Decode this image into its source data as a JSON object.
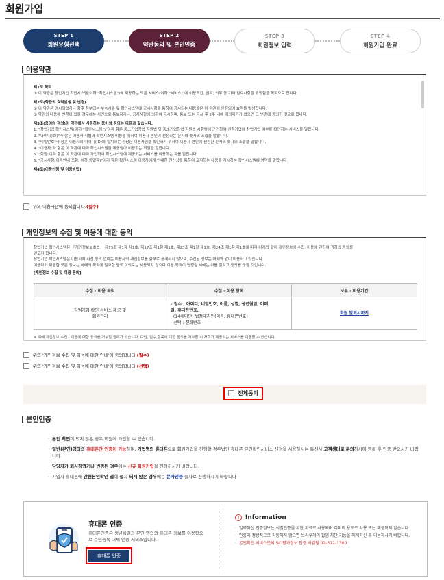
{
  "page": {
    "title": "회원가입"
  },
  "steps": [
    {
      "num": "STEP 1",
      "label": "회원유형선택"
    },
    {
      "num": "STEP 2",
      "label": "약관동의 및 본인인증"
    },
    {
      "num": "STEP 3",
      "label": "회원정보 입력"
    },
    {
      "num": "STEP 4",
      "label": "회원가입 완료"
    }
  ],
  "terms": {
    "section_title": "이용약관",
    "lines": [
      {
        "text": "제1조 목적",
        "bold": true
      },
      {
        "text": "① 이 약관은 창업기업 확인시스템(이하 \"확인시스템\")에 제공하는 모든 서비스(이하 \"서비스\")에 이용조건, 권리, 의무 등 기타 필요사항을 규정함을 목적으로 합니다.",
        "bold": false
      },
      {
        "text": "제2조(약관의 효력발생 및 변경)",
        "bold": true
      },
      {
        "text": "① 이 약관은 명시되었거나 향후 첨부되는 부속서류 및 확인시스템에 공시사항을 통하여 공시되는 내용들은 이 약관에 인정되어 효력을 발생합니다.",
        "bold": false
      },
      {
        "text": "② 약관의 내용에 변경이 있을 경우에는 서면으로 통보하거나, 공지사항에 의하여 공시하며, 통보 또는 공시 후 2주 내에 이의제기가 없으면 그 변경에 동의한 것으로 봅니다.",
        "bold": false
      },
      {
        "text": "제3조(용어의 정의)이 약관에서 사용하는 용어의 정의는 다음과 같습니다.",
        "bold": true
      },
      {
        "text": "1. \"창업기업 확인시스템(이하 \"확인시스템\")\"이라 함은 중소기업창업 지원법 및 중소기업창업 지원법 시행령에 근거하여 신청기업에 창업기업 여부를 확인하는 서비스를 말합니다.",
        "bold": false
      },
      {
        "text": "2. \"아이디(ID)\"라 함은 이용자 식별과 확인시스템 이용을 위하여 이용자 본인이 선정하는 문자와 숫자의 조합을 말합니다.",
        "bold": false
      },
      {
        "text": "3. \"비밀번호\"라 함은 이용자의 아이디(ID)와 일치하는 정당한 이용자임을 확인하기 위하여 이용자 본인이 선정한 문자와 숫자의 조합을 말합니다.",
        "bold": false
      },
      {
        "text": "4. \"이용자\"라 함은 이 약관에 따라 확인시스템을 제공받아 이용하는 회원을 말합니다.",
        "bold": false
      },
      {
        "text": "5. \"회원\"이라 함은 이 약관에 따라 가입하여 확인시스템에 제공되는 서비스를 이용하는 자를 말합니다.",
        "bold": false
      },
      {
        "text": "6. \"공시사항(이용안내 포함, 이하 동일함)\"이라 함은 확인시스템 이용자에게 안내한 전산상을 통하여 고지하는 내용을 게시하는 확인시스템에 영역을 말합니다.",
        "bold": false
      },
      {
        "text": "제4조(이용신청 및 이용방법)",
        "bold": true
      }
    ],
    "agree_label": "위의 이용약관에 동의합니다.",
    "agree_required": "(필수)"
  },
  "privacy": {
    "section_title": "개인정보의 수집 및 이용에 대한 동의",
    "intro_lines": [
      "창업기업 확인시스템은 「개인정보보호법」 제15조 제1항 제1호, 제17조 제1항 제1호, 제23조 제1항 제1호, 제24조 제1항 제1호에 따라 아래와 같이 개인정보에 수집. 이용에 관하여 귀하의 동의를",
      "얻고자 합니다.",
      "창업기업 확인시스템은 이용자에 사전 동의 없이는 이용자의 개인정보를 함부로 공개하지 않으며, 수집된 정보는 아래와 같이 이용하고 있습니다.",
      "이용자가 제공한 모든 정보는 아래의 목적에 필요한 용도 이외로는 사용되지 않으며 이용 목적이 변경될 시에는 이를 알리고 동의를 구할 것입니다."
    ],
    "table_caption": "[개인정보 수집 및 이용 동의]",
    "table_headers": [
      "수집 · 이용 목적",
      "수집 · 이용 항목",
      "보유 · 이용기간"
    ],
    "table_purpose": "창업기업 확인 서비스 제공 및\n회원관리",
    "table_items": [
      "- 필수 : 아이디, 비밀번호, 이름, 성별, 생년월일, 이메",
      "일, 휴대폰번호,",
      "  (14세미만) 법정대리인(이름, 휴대폰번호)",
      "- 선택 : 전화번호"
    ],
    "table_period": "회원 탈퇴시까지",
    "note": "※ 위에 개인정보 수집 · 이용에 대한 동의를 거부할 권리가 있습니다. 다만, 필수 항목에 대한 동의를 거부할 시 저희가 제공하는 서비스를 이용할 수 없습니다.",
    "agree_required_label": "위의 '개인정보 수집 및 이용에 대한 안내'에 동의합니다.",
    "agree_required_tag": "(필수)",
    "agree_optional_label": "위의 '개인정보 수집 및 이용에 대한 안내'에 동의합니다.",
    "agree_optional_tag": "(선택)"
  },
  "agree_all": {
    "label": "전체동의"
  },
  "identity": {
    "section_title": "본인인증",
    "notes": [
      {
        "a": "본인 확인",
        "b": "이 되지 않은 경우 회원에 가입할 수 없습니다."
      },
      {
        "a": "일반(본인)명의의",
        "b": " 휴대폰만 인증이 가능",
        "c": "하며, ",
        "d": "기업명의 휴대폰",
        "e": "으로 회원가입을 진행할 경우법인 휴대폰 본인확인서비스 신청을 사용하시는 통신사 ",
        "f": "고객센터로 문의",
        "g": "하시어 등록 후 인증 받으시기 바랍니다."
      },
      {
        "a": "담당자가 퇴사하였거나 변경된 경우",
        "b": "에는 ",
        "c": "신규 회원가입",
        "d": "을 진행하시기 바랍니다."
      },
      {
        "a": "가입자 휴대폰에 ",
        "b": "간편본인확인 앱이 설치 되지 않은 경우",
        "c": "에는 ",
        "d": "문자인증",
        "e": " 절차로 진행하시기 바랍니다"
      }
    ]
  },
  "phone_auth": {
    "title": "휴대폰 인증",
    "desc": "휴대폰인증은 생년월일과 본인 명의의 휴대폰 정보를 이용함으로 주민등록 대체 인증 서비스입니다.",
    "button": "휴대폰 인증"
  },
  "information": {
    "title": "Information",
    "items": [
      {
        "text": "입력하신 인증정보는 식별인증을 위한 자료로 사용되며 이외의 용도로 사용 또는 제공되지 않습니다.",
        "red": false
      },
      {
        "text": "인증이 정상적으로 작동하지 않으면 브라우저의 팝업 차단 기능을 해제하신 후 이용하시기 바랍니다.",
        "red": false
      },
      {
        "text": "본인확인 서비스문의 SCI평가정보 인증 사업팀 02-512-1300",
        "red": true
      }
    ]
  }
}
